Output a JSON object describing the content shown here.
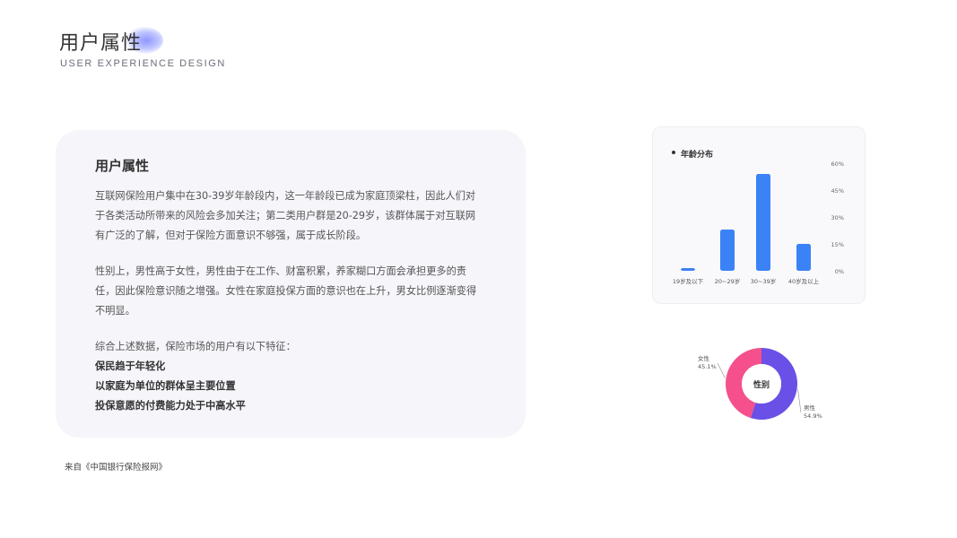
{
  "header": {
    "title": "用户属性",
    "subtitle": "USER EXPERIENCE DESIGN"
  },
  "card": {
    "heading": "用户属性",
    "paragraphs": [
      "互联网保险用户集中在30-39岁年龄段内，这一年龄段已成为家庭顶梁柱，因此人们对于各类活动所带来的风险会多加关注；第二类用户群是20-29岁，该群体属于对互联网有广泛的了解，但对于保险方面意识不够强，属于成长阶段。",
      "性别上，男性高于女性，男性由于在工作、财富积累，养家糊口方面会承担更多的责任，因此保险意识随之增强。女性在家庭投保方面的意识也在上升，男女比例逐渐变得不明显。",
      "综合上述数据，保险市场的用户有以下特征："
    ],
    "features": [
      "保民趋于年轻化",
      "以家庭为单位的群体呈主要位置",
      "投保意愿的付费能力处于中高水平"
    ]
  },
  "source": "来自《中国银行保险报网》",
  "colors": {
    "bar": "#3b82f6",
    "male": "#6a50e6",
    "female": "#f5508c",
    "card_bg": "#f5f5fa"
  },
  "chart_data": [
    {
      "type": "bar",
      "title": "年龄分布",
      "categories": [
        "19岁及以下",
        "20~29岁",
        "30~39岁",
        "40岁及以上"
      ],
      "values": [
        1,
        23,
        54,
        15
      ],
      "ylim": [
        0,
        60
      ],
      "yticks": [
        "60%",
        "45%",
        "30%",
        "15%",
        "0%"
      ],
      "axis_position": "right",
      "grid": false
    },
    {
      "type": "pie",
      "center_label": "性别",
      "slices": [
        {
          "name": "男性",
          "value": 54.9,
          "label": "54.9%"
        },
        {
          "name": "女性",
          "value": 45.1,
          "label": "45.1%"
        }
      ]
    }
  ]
}
